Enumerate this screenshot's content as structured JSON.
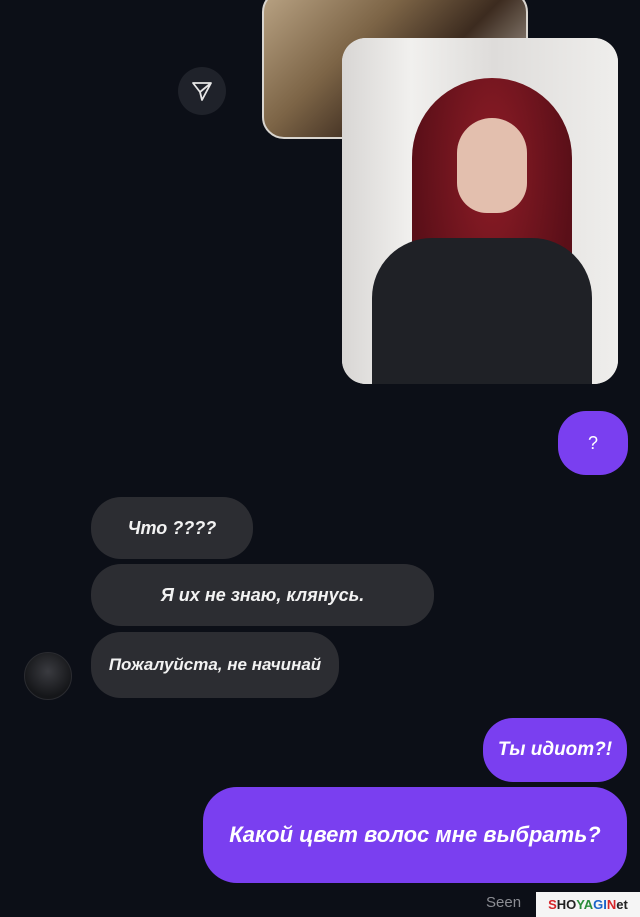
{
  "messages": {
    "sent_question": "?",
    "received": [
      "Что ????",
      "Я их не знаю, клянусь.",
      "Пожалуйста, не начинай"
    ],
    "sent": [
      "Ты идиот?!",
      "Какой цвет волос мне выбрать?"
    ],
    "status": "Seen"
  },
  "icons": {
    "share": "paper-plane-icon",
    "avatar": "avatar"
  },
  "colors": {
    "background": "#0c0f17",
    "sent_bubble": "#7a3ff0",
    "received_bubble": "#2c2d32"
  },
  "watermark": "SHOYAGINet"
}
